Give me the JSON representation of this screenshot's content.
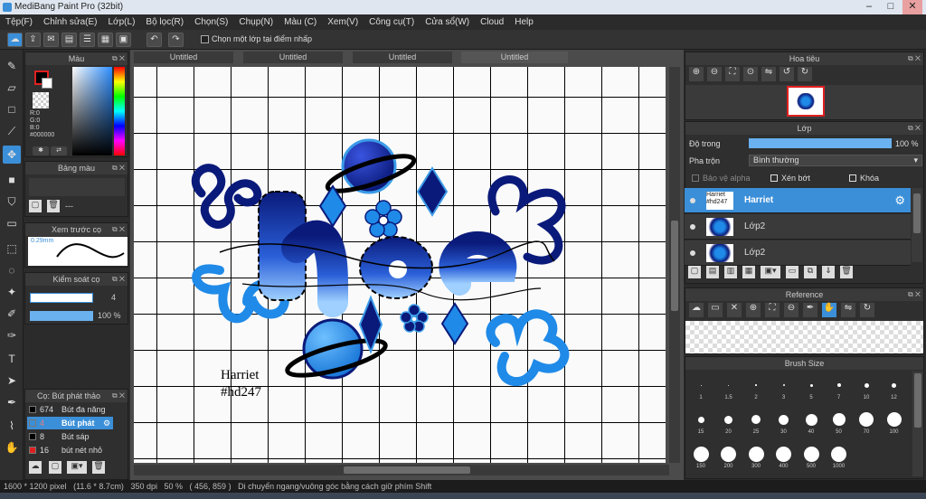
{
  "window": {
    "title": "MediBang Paint Pro (32bit)",
    "minimize": "–",
    "maximize": "□",
    "close": "✕"
  },
  "menu": [
    "Tệp(F)",
    "Chỉnh sửa(E)",
    "Lớp(L)",
    "Bộ lọc(R)",
    "Chọn(S)",
    "Chụp(N)",
    "Màu (C)",
    "Xem(V)",
    "Công cụ(T)",
    "Cửa sổ(W)",
    "Cloud",
    "Help"
  ],
  "toolbar": {
    "select_one_layer_label": "Chọn một lớp tại điểm nhấp"
  },
  "color_panel": {
    "title": "Màu",
    "r": "R:0",
    "g": "G:0",
    "b": "B:0",
    "hex": "#000000",
    "foreground": "#000000",
    "background": "#ffffff"
  },
  "palette_panel": {
    "title": "Bảng màu",
    "dash": "---"
  },
  "preview_panel": {
    "title": "Xem trước cọ",
    "size": "0.29mm"
  },
  "control_panel": {
    "title": "Kiểm soát cọ",
    "size_value": "4",
    "opacity_value": "100 %",
    "opacity_percent": 100
  },
  "brush_list": {
    "title": "Cọ: Bút phát thảo",
    "items": [
      {
        "size": "674",
        "name": "Bút đa năng",
        "color": "#000000"
      },
      {
        "size": "4",
        "name": "Bút phát",
        "color": "#3b8fd8"
      },
      {
        "size": "8",
        "name": "Bút sáp",
        "color": "#000000"
      },
      {
        "size": "16",
        "name": "bút nét nhỏ",
        "color": "#e02020"
      }
    ]
  },
  "tabs": [
    "Untitled",
    "Untitled",
    "Untitled",
    "Untitled"
  ],
  "canvas": {
    "signature_line1": "Harriet",
    "signature_line2": "#hd247"
  },
  "navigator_panel": {
    "title": "Hoa tiêu"
  },
  "layer_panel": {
    "title": "Lớp",
    "opacity_label": "Độ trong",
    "opacity_value": "100 %",
    "opacity_percent": 100,
    "blend_label": "Pha trộn",
    "blend_value": "Bình thường",
    "protect_alpha": "Bảo vệ alpha",
    "clipping": "Xén bớt",
    "lock": "Khóa",
    "layers": [
      {
        "name": "Harriet",
        "thumb_line1": "Harriet",
        "thumb_line2": "#hd247",
        "selected": true
      },
      {
        "name": "Lớp2",
        "thumb_line1": "",
        "thumb_line2": "",
        "selected": false
      },
      {
        "name": "Lớp2",
        "thumb_line1": "",
        "thumb_line2": "",
        "selected": false
      }
    ]
  },
  "reference_panel": {
    "title": "Reference"
  },
  "brush_size_panel": {
    "title": "Brush Size",
    "sizes": [
      "1",
      "1.5",
      "2",
      "3",
      "5",
      "7",
      "10",
      "12",
      "15",
      "20",
      "25",
      "30",
      "40",
      "50",
      "70",
      "100",
      "150",
      "200",
      "300",
      "400",
      "500",
      "1000"
    ]
  },
  "status": {
    "dimensions": "1600 * 1200 pixel",
    "physical": "(11.6 * 8.7cm)",
    "dpi": "350 dpi",
    "zoom": "50 %",
    "coords": "( 456, 859 )",
    "hint": "Di chuyển ngang/vuông góc bằng cách giữ phím Shift"
  },
  "colors": {
    "accent": "#3b8fd8",
    "dark_blue": "#0a1a7a",
    "light_blue": "#3b9be8"
  }
}
